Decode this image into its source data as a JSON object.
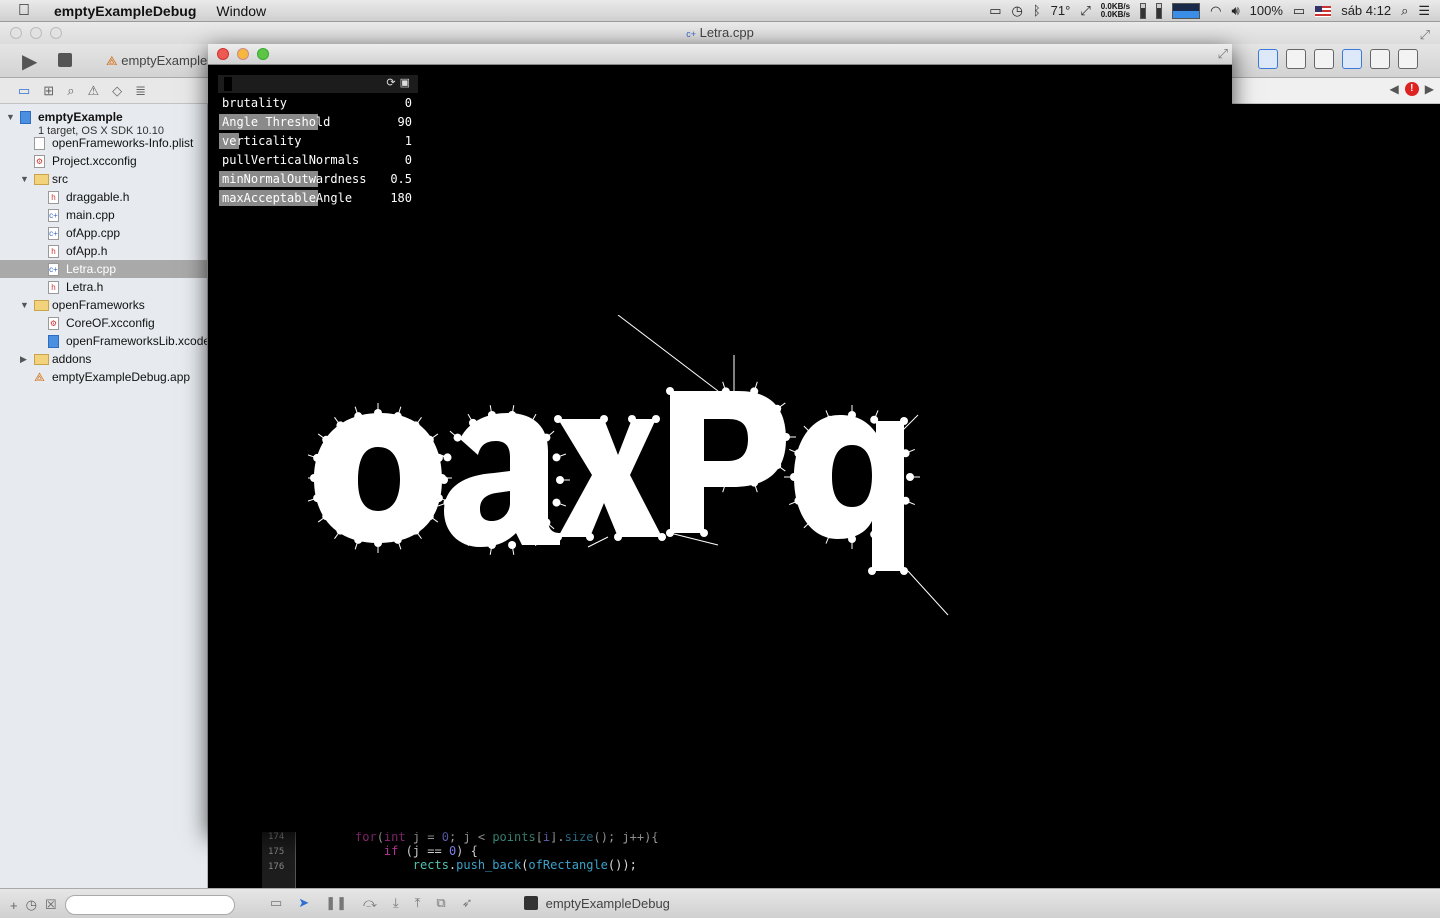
{
  "menubar": {
    "app_name": "emptyExampleDebug",
    "menus": [
      "Window"
    ],
    "status": {
      "temperature": "71°",
      "net_up": "0.0KB/s",
      "net_down": "0.0KB/s",
      "battery": "100%",
      "clock": "sáb 4:12"
    }
  },
  "xcode": {
    "window_title": "Letra.cpp",
    "scheme_label": "emptyExample",
    "tree": [
      {
        "label": "emptyExample",
        "sub": "1 target, OS X SDK 10.10",
        "type": "proj",
        "indent": 0,
        "expanded": true
      },
      {
        "label": "openFrameworks-Info.plist",
        "type": "plist",
        "indent": 1
      },
      {
        "label": "Project.xcconfig",
        "type": "xcconfig",
        "indent": 1
      },
      {
        "label": "src",
        "type": "folder",
        "indent": 1,
        "expanded": true
      },
      {
        "label": "draggable.h",
        "type": "h",
        "indent": 2
      },
      {
        "label": "main.cpp",
        "type": "cpp",
        "indent": 2
      },
      {
        "label": "ofApp.cpp",
        "type": "cpp",
        "indent": 2
      },
      {
        "label": "ofApp.h",
        "type": "h",
        "indent": 2
      },
      {
        "label": "Letra.cpp",
        "type": "cpp",
        "indent": 2,
        "selected": true
      },
      {
        "label": "Letra.h",
        "type": "h",
        "indent": 2
      },
      {
        "label": "openFrameworks",
        "type": "folder",
        "indent": 1,
        "expanded": true
      },
      {
        "label": "CoreOF.xcconfig",
        "type": "xcconfig",
        "indent": 2
      },
      {
        "label": "openFrameworksLib.xcodeproj",
        "type": "proj",
        "indent": 2
      },
      {
        "label": "addons",
        "type": "folder",
        "indent": 1,
        "expanded": false
      },
      {
        "label": "emptyExampleDebug.app",
        "type": "app",
        "indent": 1
      }
    ],
    "code": {
      "line_numbers": [
        "174",
        "175",
        "176"
      ],
      "lines": [
        [
          [
            "kw",
            "for"
          ],
          [
            "tx",
            "("
          ],
          [
            "kw",
            "int"
          ],
          [
            "tx",
            " j = "
          ],
          [
            "nm",
            "0"
          ],
          [
            "tx",
            "; j < "
          ],
          [
            "id",
            "points"
          ],
          [
            "tx",
            "["
          ],
          [
            "nm",
            "i"
          ],
          [
            "tx",
            "]."
          ],
          [
            "fn",
            "size"
          ],
          [
            "tx",
            "(); j++){"
          ]
        ],
        [
          [
            "tx",
            "    "
          ],
          [
            "kw",
            "if"
          ],
          [
            "tx",
            " (j == "
          ],
          [
            "nm",
            "0"
          ],
          [
            "tx",
            ") {"
          ]
        ],
        [
          [
            "tx",
            "        "
          ],
          [
            "id",
            "rects"
          ],
          [
            "tx",
            "."
          ],
          [
            "fn",
            "push_back"
          ],
          [
            "tx",
            "("
          ],
          [
            "fn",
            "ofRectangle"
          ],
          [
            "tx",
            "());"
          ]
        ]
      ]
    },
    "debug_target": "emptyExampleDebug"
  },
  "of_window": {
    "gui": {
      "params": [
        {
          "name": "brutality",
          "value": "0",
          "fill": 0.0
        },
        {
          "name": "Angle Threshold",
          "value": "90",
          "fill": 0.5
        },
        {
          "name": "verticality",
          "value": "1",
          "fill": 0.1
        },
        {
          "name": "pullVerticalNormals",
          "value": "0",
          "fill": 0.0
        },
        {
          "name": "minNormalOutwardness",
          "value": "0.5",
          "fill": 0.5
        },
        {
          "name": "maxAcceptableAngle",
          "value": "180",
          "fill": 0.5
        }
      ]
    },
    "rendered_text": "oaxPq"
  }
}
